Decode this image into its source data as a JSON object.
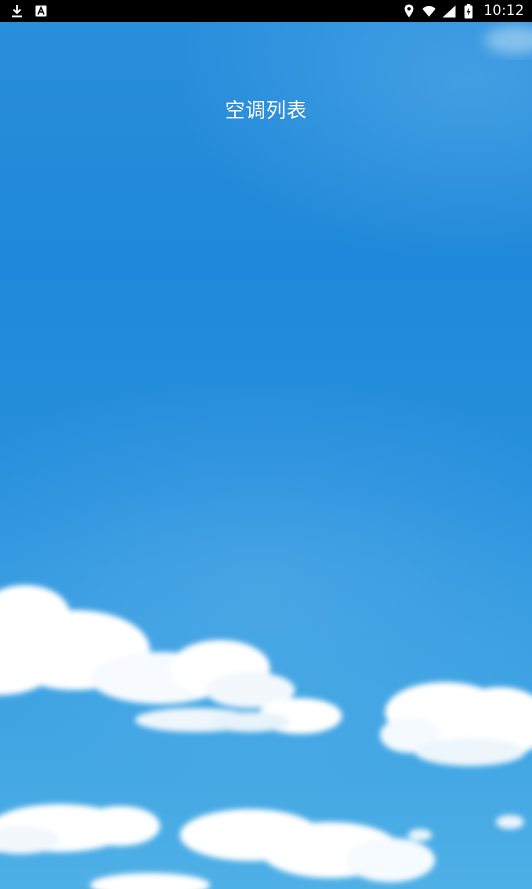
{
  "status_bar": {
    "time": "10:12",
    "left_icons": [
      "download-icon",
      "font-icon"
    ],
    "right_icons": [
      "location-icon",
      "wifi-icon",
      "signal-icon",
      "battery-icon"
    ]
  },
  "header": {
    "title": "空调列表"
  },
  "colors": {
    "status_bar_bg": "#000000",
    "sky_top": "#2a8fdc",
    "sky_bottom": "#4fb0e6",
    "title_text": "#ffffff"
  }
}
